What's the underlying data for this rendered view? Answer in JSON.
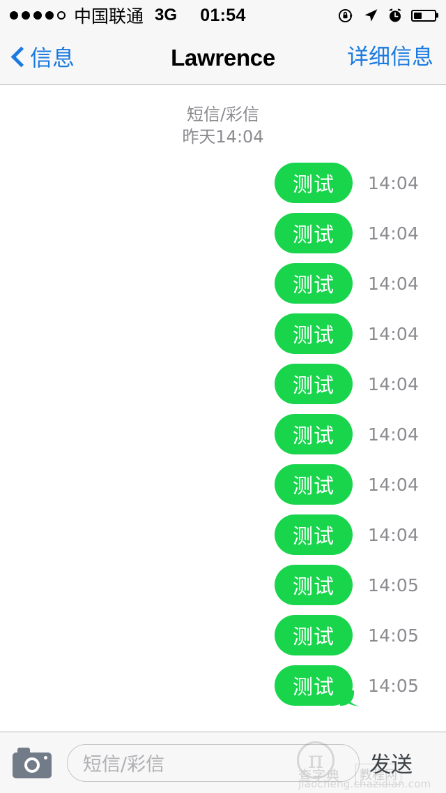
{
  "status_bar": {
    "signal_dots_filled": 4,
    "signal_dots_total": 5,
    "carrier": "中国联通",
    "network": "3G",
    "time": "01:54",
    "icons": [
      "rotation-lock-icon",
      "location-arrow-icon",
      "alarm-clock-icon",
      "battery-icon"
    ],
    "battery_percent": 40
  },
  "nav_bar": {
    "back_label": "信息",
    "title": "Lawrence",
    "right_label": "详细信息",
    "accent_color": "#1a7ae0"
  },
  "conversation": {
    "date_header_line1": "短信/彩信",
    "date_header_line2": "昨天14:04",
    "bubble_color": "#18d54c",
    "time_color": "#8a8a8f",
    "messages": [
      {
        "text": "测试",
        "time": "14:04",
        "tail": false
      },
      {
        "text": "测试",
        "time": "14:04",
        "tail": false
      },
      {
        "text": "测试",
        "time": "14:04",
        "tail": false
      },
      {
        "text": "测试",
        "time": "14:04",
        "tail": false
      },
      {
        "text": "测试",
        "time": "14:04",
        "tail": false
      },
      {
        "text": "测试",
        "time": "14:04",
        "tail": false
      },
      {
        "text": "测试",
        "time": "14:04",
        "tail": false
      },
      {
        "text": "测试",
        "time": "14:04",
        "tail": false
      },
      {
        "text": "测试",
        "time": "14:05",
        "tail": false
      },
      {
        "text": "测试",
        "time": "14:05",
        "tail": false
      },
      {
        "text": "测试",
        "time": "14:05",
        "tail": true
      }
    ]
  },
  "input_bar": {
    "camera_icon": "camera-icon",
    "input_placeholder": "短信/彩信",
    "input_value": "",
    "send_label": "发送"
  },
  "watermark": {
    "logo": "π",
    "site_name": "查字典",
    "section": "教程网",
    "url": "jiaocheng.chazidian.com"
  }
}
